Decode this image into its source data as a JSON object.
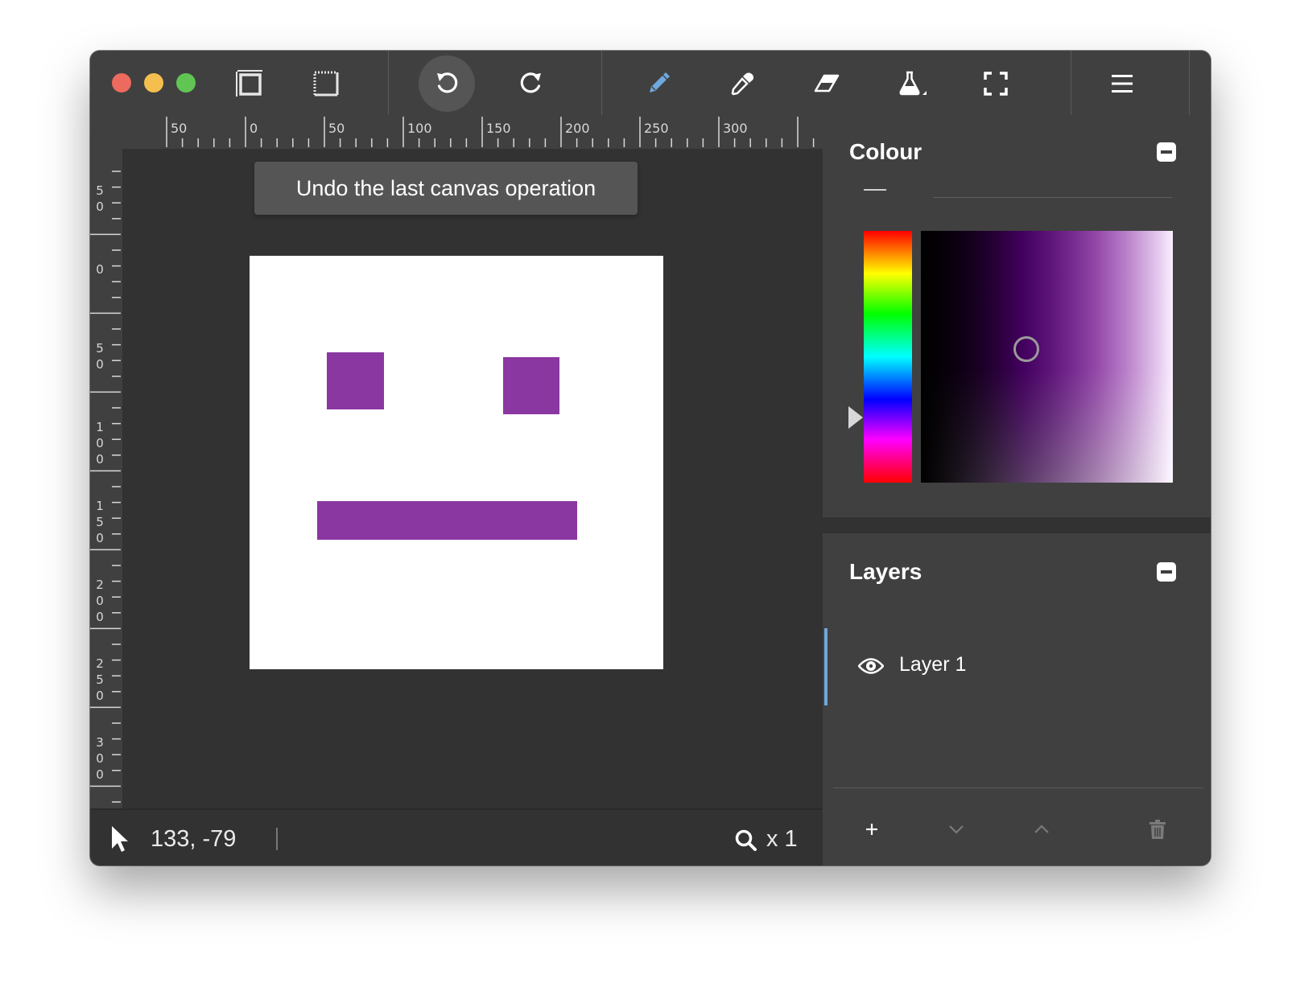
{
  "toolbar": {
    "buttons": [
      "frame-icon",
      "crop-icon",
      "undo-icon",
      "redo-icon",
      "pencil-icon",
      "eyedropper-icon",
      "eraser-icon",
      "flask-icon",
      "fullscreen-icon",
      "menu-icon"
    ],
    "active": "undo-icon"
  },
  "tooltip": {
    "text": "Undo the last canvas operation"
  },
  "ruler": {
    "horizontal": [
      "50",
      "0",
      "50",
      "100",
      "150",
      "200",
      "250",
      "300"
    ],
    "vertical": [
      "5\n0",
      "0",
      "5\n0",
      "1\n0\n0",
      "1\n5\n0",
      "2\n0\n0",
      "2\n5\n0",
      "3\n0\n0"
    ]
  },
  "canvas": {
    "background": "#ffffff",
    "shape_color": "#8a37a2"
  },
  "status": {
    "coords": "133, -79",
    "zoom": "x 1"
  },
  "colour_panel": {
    "title": "Colour",
    "selected_hue": "#b400ff"
  },
  "layers_panel": {
    "title": "Layers",
    "layers": [
      {
        "name": "Layer 1",
        "visible": true
      }
    ]
  },
  "colors": {
    "window_bg": "#323232",
    "panel_bg": "#404040",
    "accent": "#6fa8dc"
  }
}
